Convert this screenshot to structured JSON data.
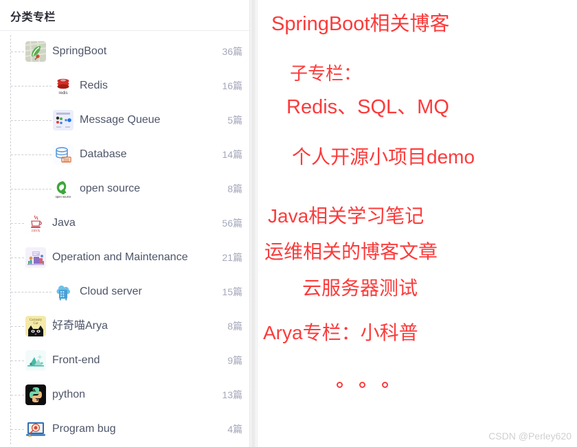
{
  "panel": {
    "title": "分类专栏",
    "count_suffix": "篇",
    "items": [
      {
        "label": "SpringBoot",
        "count": "36篇",
        "level": 1,
        "icon": "springboot-icon"
      },
      {
        "label": "Redis",
        "count": "16篇",
        "level": 2,
        "icon": "redis-icon"
      },
      {
        "label": "Message Queue",
        "count": "5篇",
        "level": 2,
        "icon": "message-queue-icon"
      },
      {
        "label": "Database",
        "count": "14篇",
        "level": 2,
        "icon": "database-icon"
      },
      {
        "label": "open source",
        "count": "8篇",
        "level": 2,
        "icon": "open-source-icon"
      },
      {
        "label": "Java",
        "count": "56篇",
        "level": 1,
        "icon": "java-icon"
      },
      {
        "label": "Operation and Maintenance",
        "count": "21篇",
        "level": 1,
        "icon": "operation-maintenance-icon"
      },
      {
        "label": "Cloud server",
        "count": "15篇",
        "level": 2,
        "icon": "cloud-server-icon"
      },
      {
        "label": "好奇喵Arya",
        "count": "8篇",
        "level": 1,
        "icon": "curiosity-cat-icon"
      },
      {
        "label": "Front-end",
        "count": "9篇",
        "level": 1,
        "icon": "front-end-icon"
      },
      {
        "label": "python",
        "count": "13篇",
        "level": 1,
        "icon": "python-icon"
      },
      {
        "label": "Program bug",
        "count": "4篇",
        "level": 1,
        "icon": "program-bug-icon"
      }
    ]
  },
  "annotations": {
    "color": "#fb3b3b",
    "notes": [
      "SpringBoot相关博客",
      "子专栏：",
      "Redis、SQL、MQ",
      "个人开源小项目demo",
      "Java相关学习笔记",
      "运维相关的博客文章",
      "云服务器测试",
      "Arya专栏：小科普"
    ],
    "ellipsis_dots": 3
  },
  "watermark": {
    "text": "CSDN @Perley620",
    "color": "#d0d0d2"
  },
  "colors": {
    "label_text": "#4e5569",
    "count_text": "#a5a8bb",
    "title_text": "#2b2b36",
    "tree_line": "#cdcdd4",
    "divider": "#ededf0",
    "background": "#ffffff"
  }
}
